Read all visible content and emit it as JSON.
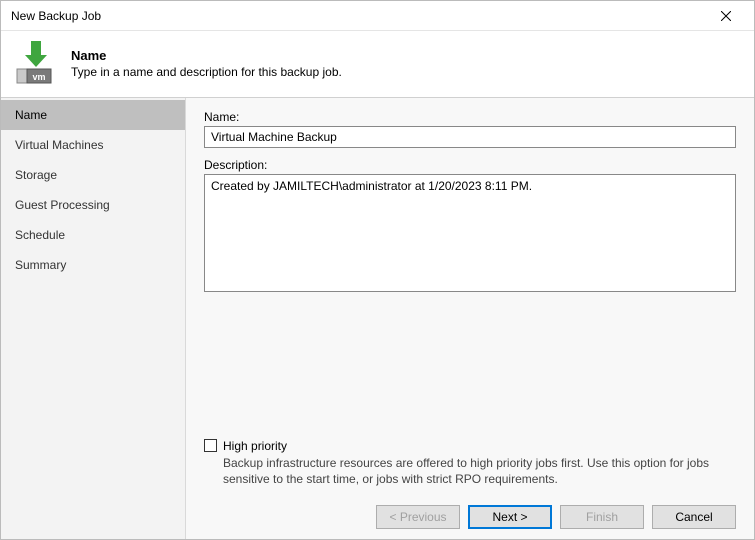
{
  "window": {
    "title": "New Backup Job"
  },
  "header": {
    "title": "Name",
    "subtitle": "Type in a name and description for this backup job."
  },
  "sidebar": {
    "items": [
      {
        "label": "Name",
        "active": true
      },
      {
        "label": "Virtual Machines",
        "active": false
      },
      {
        "label": "Storage",
        "active": false
      },
      {
        "label": "Guest Processing",
        "active": false
      },
      {
        "label": "Schedule",
        "active": false
      },
      {
        "label": "Summary",
        "active": false
      }
    ]
  },
  "form": {
    "name_label": "Name:",
    "name_value": "Virtual Machine Backup",
    "description_label": "Description:",
    "description_value": "Created by JAMILTECH\\administrator at 1/20/2023 8:11 PM.",
    "high_priority_label": "High priority",
    "high_priority_checked": false,
    "high_priority_desc": "Backup infrastructure resources are offered to high priority jobs first. Use this option for jobs sensitive to the start time, or jobs with strict RPO requirements."
  },
  "buttons": {
    "previous": "< Previous",
    "next": "Next >",
    "finish": "Finish",
    "cancel": "Cancel"
  }
}
